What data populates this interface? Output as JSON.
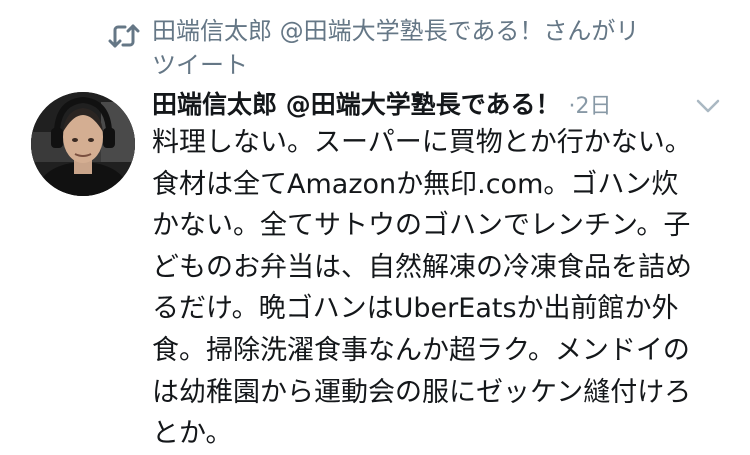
{
  "retweet": {
    "icon": "retweet-icon",
    "line1": "田端信太郎 @田端大学塾長である！さんがリ",
    "line2": "ツイート"
  },
  "author": {
    "avatar_icon": "avatar-photo",
    "display_name": "田端信太郎 @田端大学塾長である！",
    "separator": "·",
    "time": "2日"
  },
  "menu": {
    "icon": "chevron-down-icon"
  },
  "body_lines": [
    "料理しない。スーパーに買物とか行かない。",
    "食材は全てAmazonか無印.com。ゴハン炊",
    "かない。全てサトウのゴハンでレンチン。子",
    "どものお弁当は、自然解凍の冷凍食品を詰め",
    "るだけ。晩ゴハンはUberEatsか出前館か外",
    "食。掃除洗濯食事なんか超ラク。メンドイの",
    "は幼稚園から運動会の服にゼッケン縫付けろ",
    "とか。"
  ],
  "colors": {
    "text": "#14171a",
    "secondary": "#657786",
    "meta": "#8899a6",
    "background": "#ffffff"
  }
}
